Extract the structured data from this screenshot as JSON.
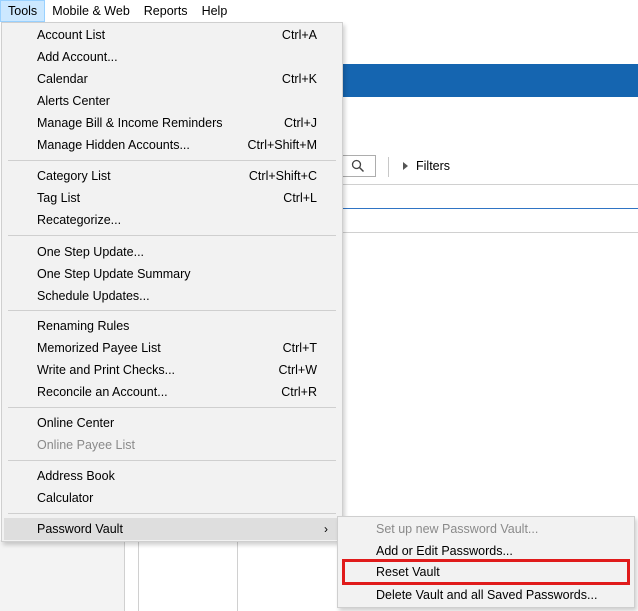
{
  "menubar": {
    "items": [
      {
        "label": "Tools",
        "active": true
      },
      {
        "label": "Mobile & Web"
      },
      {
        "label": "Reports"
      },
      {
        "label": "Help"
      }
    ]
  },
  "background": {
    "filters_label": "Filters"
  },
  "tools_menu": {
    "items": [
      {
        "label": "Account List",
        "shortcut": "Ctrl+A"
      },
      {
        "label": "Add Account...",
        "shortcut": ""
      },
      {
        "label": "Calendar",
        "shortcut": "Ctrl+K"
      },
      {
        "label": "Alerts Center",
        "shortcut": ""
      },
      {
        "label": "Manage Bill & Income Reminders",
        "shortcut": "Ctrl+J"
      },
      {
        "label": "Manage Hidden Accounts...",
        "shortcut": "Ctrl+Shift+M"
      },
      {
        "label": "Category List",
        "shortcut": "Ctrl+Shift+C"
      },
      {
        "label": "Tag List",
        "shortcut": "Ctrl+L"
      },
      {
        "label": "Recategorize...",
        "shortcut": ""
      },
      {
        "label": "One Step Update...",
        "shortcut": ""
      },
      {
        "label": "One Step Update Summary",
        "shortcut": ""
      },
      {
        "label": "Schedule Updates...",
        "shortcut": ""
      },
      {
        "label": "Renaming Rules",
        "shortcut": ""
      },
      {
        "label": "Memorized Payee List",
        "shortcut": "Ctrl+T"
      },
      {
        "label": "Write and Print Checks...",
        "shortcut": "Ctrl+W"
      },
      {
        "label": "Reconcile an Account...",
        "shortcut": "Ctrl+R"
      },
      {
        "label": "Online Center",
        "shortcut": ""
      },
      {
        "label": "Online Payee List",
        "shortcut": "",
        "disabled": true
      },
      {
        "label": "Address Book",
        "shortcut": ""
      },
      {
        "label": "Calculator",
        "shortcut": ""
      },
      {
        "label": "Password Vault",
        "shortcut": "",
        "submenu": true
      }
    ]
  },
  "password_vault_submenu": {
    "items": [
      {
        "label": "Set up new Password Vault...",
        "disabled": true
      },
      {
        "label": "Add or Edit Passwords..."
      },
      {
        "label": "Reset Vault",
        "highlighted": true
      },
      {
        "label": "Delete Vault and all Saved Passwords..."
      }
    ]
  },
  "colors": {
    "accent_blue": "#1565b0",
    "highlight_box": "#e01b1b",
    "menu_active_bg": "#cce8ff"
  }
}
